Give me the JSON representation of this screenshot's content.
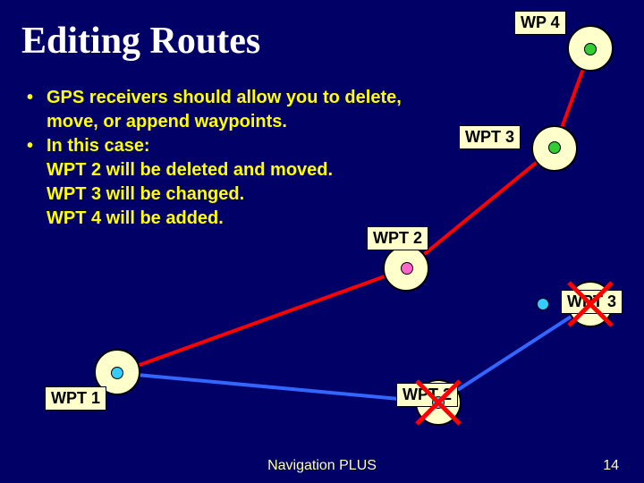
{
  "title": "Editing Routes",
  "bullets": [
    {
      "dot": true,
      "text": "GPS receivers should allow you to delete, move, or append waypoints."
    },
    {
      "dot": true,
      "text": "In this case:"
    },
    {
      "dot": false,
      "text": "WPT 2 will be deleted and moved."
    },
    {
      "dot": false,
      "text": "WPT 3 will be changed."
    },
    {
      "dot": false,
      "text": "WPT 4 will be added."
    }
  ],
  "waypoints": {
    "wp4": "WP 4",
    "wpt3_upper": "WPT 3",
    "wpt2_upper": "WPT 2",
    "wpt3_lower": "WPT 3",
    "wpt2_lower": "WPT 2",
    "wpt1": "WPT 1"
  },
  "footer": {
    "center": "Navigation PLUS",
    "page": "14"
  },
  "colors": {
    "bg": "#000066",
    "text_title": "#ffffff",
    "text_body": "#ffff00",
    "label_bg": "#ffffcc",
    "line_old": "#3366ff",
    "line_new": "#ff0000"
  }
}
